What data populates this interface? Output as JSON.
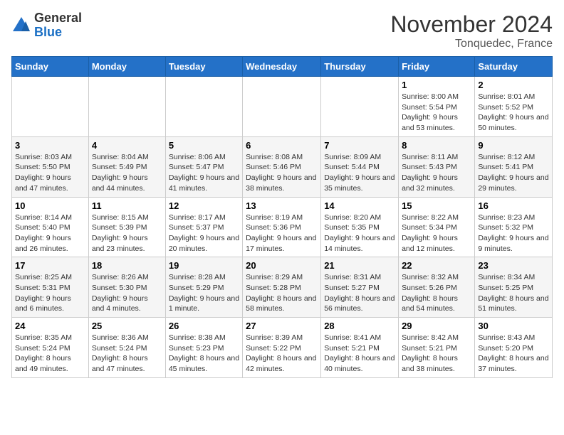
{
  "header": {
    "logo_general": "General",
    "logo_blue": "Blue",
    "month_title": "November 2024",
    "location": "Tonquedec, France"
  },
  "days_of_week": [
    "Sunday",
    "Monday",
    "Tuesday",
    "Wednesday",
    "Thursday",
    "Friday",
    "Saturday"
  ],
  "weeks": [
    [
      {
        "day": "",
        "detail": ""
      },
      {
        "day": "",
        "detail": ""
      },
      {
        "day": "",
        "detail": ""
      },
      {
        "day": "",
        "detail": ""
      },
      {
        "day": "",
        "detail": ""
      },
      {
        "day": "1",
        "detail": "Sunrise: 8:00 AM\nSunset: 5:54 PM\nDaylight: 9 hours and 53 minutes."
      },
      {
        "day": "2",
        "detail": "Sunrise: 8:01 AM\nSunset: 5:52 PM\nDaylight: 9 hours and 50 minutes."
      }
    ],
    [
      {
        "day": "3",
        "detail": "Sunrise: 8:03 AM\nSunset: 5:50 PM\nDaylight: 9 hours and 47 minutes."
      },
      {
        "day": "4",
        "detail": "Sunrise: 8:04 AM\nSunset: 5:49 PM\nDaylight: 9 hours and 44 minutes."
      },
      {
        "day": "5",
        "detail": "Sunrise: 8:06 AM\nSunset: 5:47 PM\nDaylight: 9 hours and 41 minutes."
      },
      {
        "day": "6",
        "detail": "Sunrise: 8:08 AM\nSunset: 5:46 PM\nDaylight: 9 hours and 38 minutes."
      },
      {
        "day": "7",
        "detail": "Sunrise: 8:09 AM\nSunset: 5:44 PM\nDaylight: 9 hours and 35 minutes."
      },
      {
        "day": "8",
        "detail": "Sunrise: 8:11 AM\nSunset: 5:43 PM\nDaylight: 9 hours and 32 minutes."
      },
      {
        "day": "9",
        "detail": "Sunrise: 8:12 AM\nSunset: 5:41 PM\nDaylight: 9 hours and 29 minutes."
      }
    ],
    [
      {
        "day": "10",
        "detail": "Sunrise: 8:14 AM\nSunset: 5:40 PM\nDaylight: 9 hours and 26 minutes."
      },
      {
        "day": "11",
        "detail": "Sunrise: 8:15 AM\nSunset: 5:39 PM\nDaylight: 9 hours and 23 minutes."
      },
      {
        "day": "12",
        "detail": "Sunrise: 8:17 AM\nSunset: 5:37 PM\nDaylight: 9 hours and 20 minutes."
      },
      {
        "day": "13",
        "detail": "Sunrise: 8:19 AM\nSunset: 5:36 PM\nDaylight: 9 hours and 17 minutes."
      },
      {
        "day": "14",
        "detail": "Sunrise: 8:20 AM\nSunset: 5:35 PM\nDaylight: 9 hours and 14 minutes."
      },
      {
        "day": "15",
        "detail": "Sunrise: 8:22 AM\nSunset: 5:34 PM\nDaylight: 9 hours and 12 minutes."
      },
      {
        "day": "16",
        "detail": "Sunrise: 8:23 AM\nSunset: 5:32 PM\nDaylight: 9 hours and 9 minutes."
      }
    ],
    [
      {
        "day": "17",
        "detail": "Sunrise: 8:25 AM\nSunset: 5:31 PM\nDaylight: 9 hours and 6 minutes."
      },
      {
        "day": "18",
        "detail": "Sunrise: 8:26 AM\nSunset: 5:30 PM\nDaylight: 9 hours and 4 minutes."
      },
      {
        "day": "19",
        "detail": "Sunrise: 8:28 AM\nSunset: 5:29 PM\nDaylight: 9 hours and 1 minute."
      },
      {
        "day": "20",
        "detail": "Sunrise: 8:29 AM\nSunset: 5:28 PM\nDaylight: 8 hours and 58 minutes."
      },
      {
        "day": "21",
        "detail": "Sunrise: 8:31 AM\nSunset: 5:27 PM\nDaylight: 8 hours and 56 minutes."
      },
      {
        "day": "22",
        "detail": "Sunrise: 8:32 AM\nSunset: 5:26 PM\nDaylight: 8 hours and 54 minutes."
      },
      {
        "day": "23",
        "detail": "Sunrise: 8:34 AM\nSunset: 5:25 PM\nDaylight: 8 hours and 51 minutes."
      }
    ],
    [
      {
        "day": "24",
        "detail": "Sunrise: 8:35 AM\nSunset: 5:24 PM\nDaylight: 8 hours and 49 minutes."
      },
      {
        "day": "25",
        "detail": "Sunrise: 8:36 AM\nSunset: 5:24 PM\nDaylight: 8 hours and 47 minutes."
      },
      {
        "day": "26",
        "detail": "Sunrise: 8:38 AM\nSunset: 5:23 PM\nDaylight: 8 hours and 45 minutes."
      },
      {
        "day": "27",
        "detail": "Sunrise: 8:39 AM\nSunset: 5:22 PM\nDaylight: 8 hours and 42 minutes."
      },
      {
        "day": "28",
        "detail": "Sunrise: 8:41 AM\nSunset: 5:21 PM\nDaylight: 8 hours and 40 minutes."
      },
      {
        "day": "29",
        "detail": "Sunrise: 8:42 AM\nSunset: 5:21 PM\nDaylight: 8 hours and 38 minutes."
      },
      {
        "day": "30",
        "detail": "Sunrise: 8:43 AM\nSunset: 5:20 PM\nDaylight: 8 hours and 37 minutes."
      }
    ]
  ]
}
